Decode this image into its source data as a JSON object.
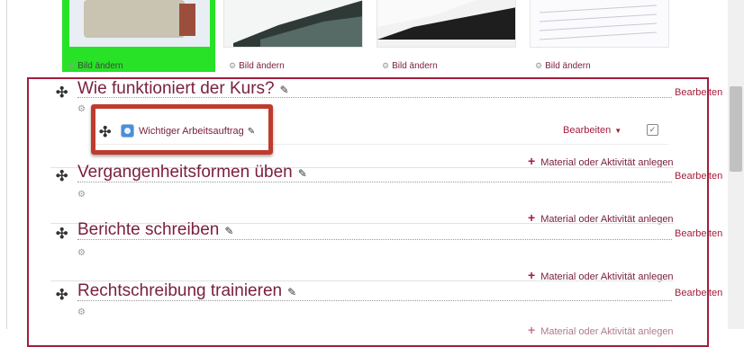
{
  "thumbnails": [
    {
      "caption": "Bild ändern",
      "active": true
    },
    {
      "caption": "Bild ändern",
      "active": false
    },
    {
      "caption": "Bild ändern",
      "active": false
    },
    {
      "caption": "Bild ändern",
      "active": false
    }
  ],
  "sections": [
    {
      "title": "Wie funktioniert der Kurs?",
      "edit_label": "Bearbeiten",
      "add_label": "Material oder Aktivität anlegen",
      "activity": {
        "name": "Wichtiger Arbeitsauftrag",
        "edit_label": "Bearbeiten"
      }
    },
    {
      "title": "Vergangenheitsformen üben",
      "edit_label": "Bearbeiten",
      "add_label": "Material oder Aktivität anlegen"
    },
    {
      "title": "Berichte schreiben",
      "edit_label": "Bearbeiten",
      "add_label": "Material oder Aktivität anlegen"
    },
    {
      "title": "Rechtschreibung trainieren",
      "edit_label": "Bearbeiten",
      "add_label": "Material oder Aktivität anlegen"
    }
  ],
  "icons": {
    "move": "move-icon",
    "edit": "pencil-icon",
    "settings": "gear-icon",
    "add": "plus-icon",
    "activity": "assignment-icon",
    "completion": "checkbox-icon"
  },
  "colors": {
    "brand": "#a31d3b",
    "link": "#7a2040",
    "active_thumb": "#27e227",
    "highlight": "#bf3b2e"
  }
}
